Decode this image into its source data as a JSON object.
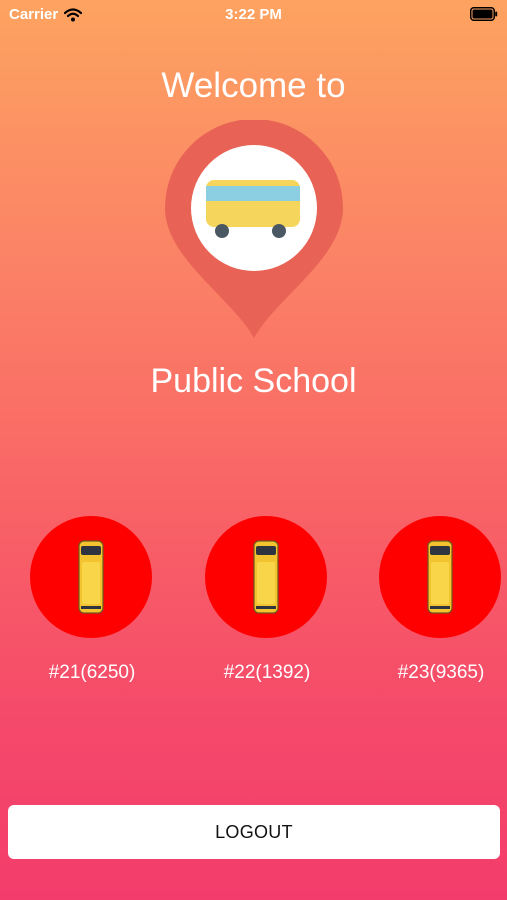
{
  "status_bar": {
    "carrier": "Carrier",
    "time": "3:22 PM"
  },
  "header": {
    "welcome": "Welcome to",
    "school_name": "Public School"
  },
  "buses": [
    {
      "label": "#21(6250)"
    },
    {
      "label": "#22(1392)"
    },
    {
      "label": "#23(9365)"
    }
  ],
  "logout_label": "LOGOUT",
  "colors": {
    "bus_circle": "#FF0000",
    "gradient_top": "#FDA360",
    "gradient_bottom": "#F33C6B"
  }
}
